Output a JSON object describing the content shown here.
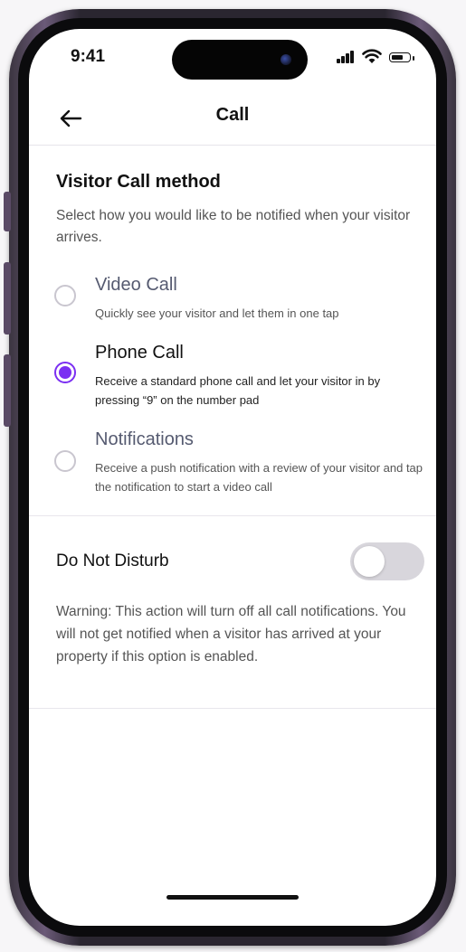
{
  "status_bar": {
    "time": "9:41",
    "icons": [
      "signal-icon",
      "wifi-icon",
      "battery-icon"
    ]
  },
  "header": {
    "back_icon": "arrow-left-icon",
    "title": "Call"
  },
  "visitor_call_method": {
    "title": "Visitor Call method",
    "description": "Select how you would like to be notified when your visitor arrives.",
    "options": [
      {
        "label": "Video Call",
        "description": "Quickly see your visitor and let them in one tap",
        "selected": false
      },
      {
        "label": "Phone Call",
        "description": "Receive a standard phone call and let your visitor in by pressing “9” on the number pad",
        "selected": true
      },
      {
        "label": "Notifications",
        "description": "Receive a push notification with a review of your visitor and tap the notification to start a video call",
        "selected": false
      }
    ]
  },
  "do_not_disturb": {
    "label": "Do Not Disturb",
    "enabled": false,
    "warning": "Warning: This action will turn off all call notifications. You will not get notified when a visitor has arrived at your property if this option is enabled."
  },
  "colors": {
    "accent": "#7b2ff2",
    "toggle_off": "#d8d6dc",
    "frame": "#3b3540"
  }
}
